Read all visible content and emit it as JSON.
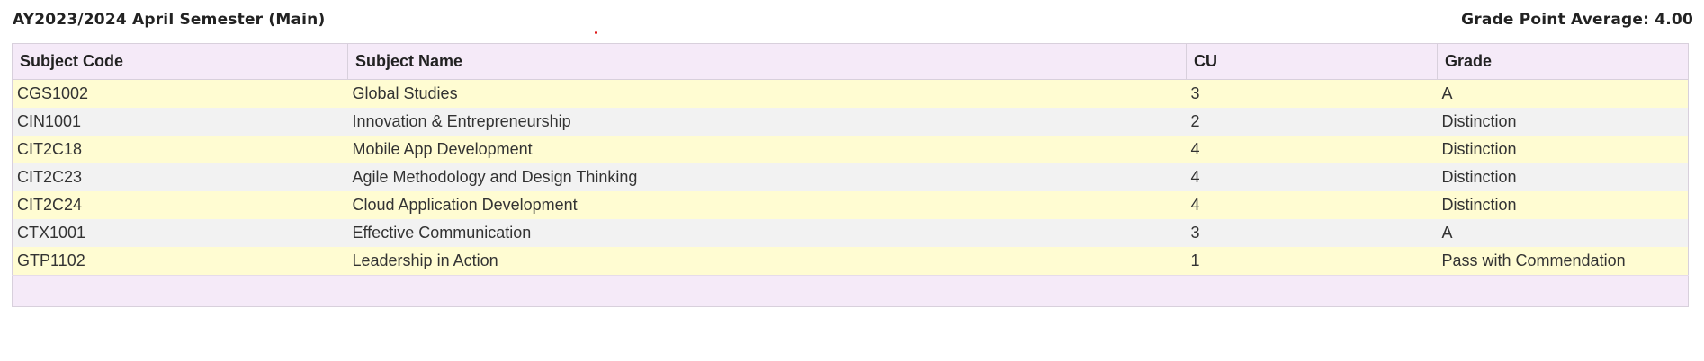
{
  "header": {
    "semester_title": "AY2023/2024 April Semester (Main)",
    "gpa_text": "Grade Point Average: 4.00"
  },
  "table": {
    "columns": [
      "Subject Code",
      "Subject Name",
      "CU",
      "Grade"
    ],
    "rows": [
      {
        "code": "CGS1002",
        "name": "Global Studies",
        "cu": "3",
        "grade": "A"
      },
      {
        "code": "CIN1001",
        "name": "Innovation & Entrepreneurship",
        "cu": "2",
        "grade": "Distinction"
      },
      {
        "code": "CIT2C18",
        "name": "Mobile App Development",
        "cu": "4",
        "grade": "Distinction"
      },
      {
        "code": "CIT2C23",
        "name": "Agile Methodology and Design Thinking",
        "cu": "4",
        "grade": "Distinction"
      },
      {
        "code": "CIT2C24",
        "name": "Cloud Application Development",
        "cu": "4",
        "grade": "Distinction"
      },
      {
        "code": "CTX1001",
        "name": "Effective Communication",
        "cu": "3",
        "grade": "A"
      },
      {
        "code": "GTP1102",
        "name": "Leadership in Action",
        "cu": "1",
        "grade": "Pass with Commendation"
      }
    ]
  },
  "colors": {
    "header_bg": "#f5eaf8",
    "row_odd_bg": "#fffcd2",
    "row_even_bg": "#f2f2f2"
  }
}
